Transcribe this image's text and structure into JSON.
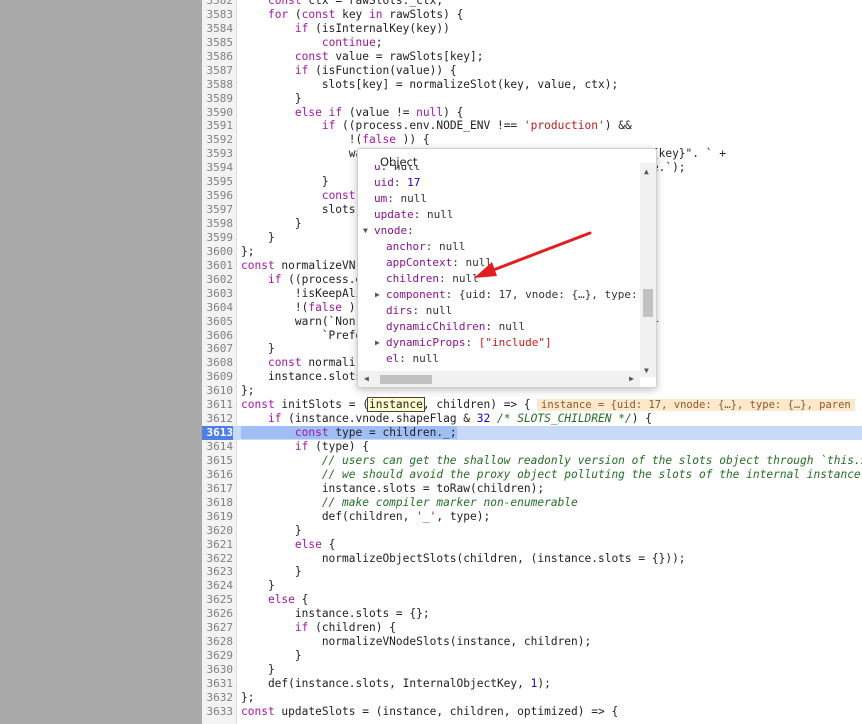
{
  "editor": {
    "lines": [
      {
        "n": "3582",
        "t": "    const ctx = rawSlots._ctx;"
      },
      {
        "n": "3583",
        "t": "    for (const key in rawSlots) {"
      },
      {
        "n": "3584",
        "t": "        if (isInternalKey(key))"
      },
      {
        "n": "3585",
        "t": "            continue;"
      },
      {
        "n": "3586",
        "t": "        const value = rawSlots[key];"
      },
      {
        "n": "3587",
        "t": "        if (isFunction(value)) {"
      },
      {
        "n": "3588",
        "t": "            slots[key] = normalizeSlot(key, value, ctx);"
      },
      {
        "n": "3589",
        "t": "        }"
      },
      {
        "n": "3590",
        "t": "        else if (value != null) {"
      },
      {
        "n": "3591",
        "t": "            if ((process.env.NODE_ENV !== 'production') &&"
      },
      {
        "n": "3592",
        "t": "                !(false )) {"
      },
      {
        "n": "3593",
        "t": "                wa                                          ${key}\". ` +"
      },
      {
        "n": "3594",
        "t": "                                                            ce.`);"
      },
      {
        "n": "3595",
        "t": "            }"
      },
      {
        "n": "3596",
        "t": "            const"
      },
      {
        "n": "3597",
        "t": "            slots["
      },
      {
        "n": "3598",
        "t": "        }"
      },
      {
        "n": "3599",
        "t": "    }"
      },
      {
        "n": "3600",
        "t": "};"
      },
      {
        "n": "3601",
        "t": "const normalizeVN"
      },
      {
        "n": "3602",
        "t": "    if ((process.e"
      },
      {
        "n": "3603",
        "t": "        !isKeepAli"
      },
      {
        "n": "3604",
        "t": "        !(false ))"
      },
      {
        "n": "3605",
        "t": "        warn(`Non-                                         ` +"
      },
      {
        "n": "3606",
        "t": "            `Prefe"
      },
      {
        "n": "3607",
        "t": "    }"
      },
      {
        "n": "3608",
        "t": "    const normali"
      },
      {
        "n": "3609",
        "t": "    instance.slots"
      },
      {
        "n": "3610",
        "t": "};"
      },
      {
        "n": "3611",
        "t": "const initSlots = (instance, children) => {"
      },
      {
        "n": "3612",
        "t": "    if (instance.vnode.shapeFlag & 32 /* SLOTS_CHILDREN */) {"
      },
      {
        "n": "3613",
        "t": "        const type = children._;"
      },
      {
        "n": "3614",
        "t": "        if (type) {"
      },
      {
        "n": "3615",
        "t": "            // users can get the shallow readonly version of the slots object through `this.$s"
      },
      {
        "n": "3616",
        "t": "            // we should avoid the proxy object polluting the slots of the internal instance"
      },
      {
        "n": "3617",
        "t": "            instance.slots = toRaw(children);"
      },
      {
        "n": "3618",
        "t": "            // make compiler marker non-enumerable"
      },
      {
        "n": "3619",
        "t": "            def(children, '_', type);"
      },
      {
        "n": "3620",
        "t": "        }"
      },
      {
        "n": "3621",
        "t": "        else {"
      },
      {
        "n": "3622",
        "t": "            normalizeObjectSlots(children, (instance.slots = {}));"
      },
      {
        "n": "3623",
        "t": "        }"
      },
      {
        "n": "3624",
        "t": "    }"
      },
      {
        "n": "3625",
        "t": "    else {"
      },
      {
        "n": "3626",
        "t": "        instance.slots = {};"
      },
      {
        "n": "3627",
        "t": "        if (children) {"
      },
      {
        "n": "3628",
        "t": "            normalizeVNodeSlots(instance, children);"
      },
      {
        "n": "3629",
        "t": "        }"
      },
      {
        "n": "3630",
        "t": "    }"
      },
      {
        "n": "3631",
        "t": "    def(instance.slots, InternalObjectKey, 1);"
      },
      {
        "n": "3632",
        "t": "};"
      },
      {
        "n": "3633",
        "t": "const updateSlots = (instance, children, optimized) => {"
      }
    ],
    "inline_value": "instance = {uid: 17, vnode: {…}, type: {…}, paren",
    "execution_line": "3613"
  },
  "popover": {
    "title": "Object",
    "props": [
      {
        "key": "u",
        "sep": ": ",
        "val": "null",
        "indent": 0,
        "tri": ""
      },
      {
        "key": "uid",
        "sep": ": ",
        "val": "17",
        "indent": 0,
        "tri": "",
        "num": true
      },
      {
        "key": "um",
        "sep": ": ",
        "val": "null",
        "indent": 0,
        "tri": ""
      },
      {
        "key": "update",
        "sep": ": ",
        "val": "null",
        "indent": 0,
        "tri": ""
      },
      {
        "key": "vnode",
        "sep": ":",
        "val": "",
        "indent": 0,
        "tri": "▼"
      },
      {
        "key": "anchor",
        "sep": ": ",
        "val": "null",
        "indent": 1,
        "tri": ""
      },
      {
        "key": "appContext",
        "sep": ": ",
        "val": "null",
        "indent": 1,
        "tri": ""
      },
      {
        "key": "children",
        "sep": ": ",
        "val": "null",
        "indent": 1,
        "tri": ""
      },
      {
        "key": "component",
        "sep": ": ",
        "val": "{uid: 17, vnode: {…}, type:",
        "indent": 1,
        "tri": "▶"
      },
      {
        "key": "dirs",
        "sep": ": ",
        "val": "null",
        "indent": 1,
        "tri": ""
      },
      {
        "key": "dynamicChildren",
        "sep": ": ",
        "val": "null",
        "indent": 1,
        "tri": ""
      },
      {
        "key": "dynamicProps",
        "sep": ": ",
        "val": "[\"include\"]",
        "indent": 1,
        "tri": "▶",
        "str": true
      },
      {
        "key": "el",
        "sep": ": ",
        "val": "null",
        "indent": 1,
        "tri": ""
      }
    ]
  },
  "colors": {
    "sidebar": "#a9a9a9",
    "exec_line": "#c9daf8",
    "exec_gutter": "#4f7fe6",
    "arrow": "#e02020"
  }
}
